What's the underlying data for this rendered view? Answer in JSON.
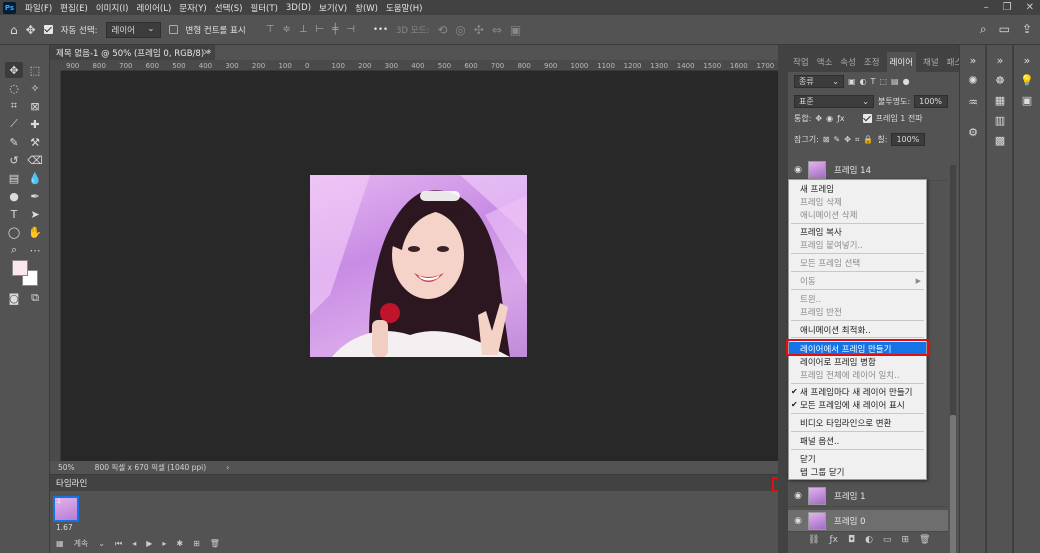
{
  "app": {
    "logo": "Ps"
  },
  "menu": [
    "파일(F)",
    "편집(E)",
    "이미지(I)",
    "레이어(L)",
    "문자(Y)",
    "선택(S)",
    "필터(T)",
    "3D(D)",
    "보기(V)",
    "창(W)",
    "도움말(H)"
  ],
  "options": {
    "auto_select_label": "자동 선택:",
    "auto_select_value": "레이어",
    "transform_label": "변형 컨트롤 표시",
    "three_d_label": "3D 모드:",
    "more": "•••"
  },
  "document": {
    "tab_title": "제목 없음-1 @ 50% (프레임 0, RGB/8) *",
    "ruler_ticks": [
      "900",
      "800",
      "700",
      "600",
      "500",
      "400",
      "300",
      "200",
      "100",
      "0",
      "100",
      "200",
      "300",
      "400",
      "500",
      "600",
      "700",
      "800",
      "900",
      "1000",
      "1100",
      "1200",
      "1300",
      "1400",
      "1500",
      "1600",
      "1700"
    ],
    "zoom": "50%",
    "size_info": "800 픽셀 x 670 픽셀 (1040 ppi)",
    "status_arrow": "›"
  },
  "timeline": {
    "title": "타임라인",
    "frame_number": "1",
    "frame_delay": "1.67",
    "loop": "계속"
  },
  "layers_panel": {
    "tabs": [
      "작업",
      "액소",
      "속성",
      "조정",
      "레이어",
      "채널",
      "패스"
    ],
    "active_tab": "레이어",
    "kind_filter": "종류",
    "blend_mode": "표준",
    "opacity_label": "불투명도:",
    "opacity_value": "100%",
    "unify_label": "통합:",
    "propagate_label": "프레임 1 전파",
    "lock_label": "잠그기:",
    "fill_label": "칠:",
    "fill_value": "100%",
    "layers": [
      {
        "name": "프레임 14",
        "selected": false
      },
      {
        "name": "프레임 1",
        "selected": false
      },
      {
        "name": "프레임 0",
        "selected": true
      }
    ]
  },
  "flyout_menu": {
    "items": [
      {
        "label": "새 프레임",
        "state": "enabled"
      },
      {
        "label": "프레임 삭제",
        "state": "disabled"
      },
      {
        "label": "애니메이션 삭제",
        "state": "disabled"
      },
      {
        "label": "프레임 복사",
        "state": "enabled"
      },
      {
        "label": "프레임 붙여넣기..",
        "state": "disabled"
      },
      {
        "label": "모든 프레임 선택",
        "state": "disabled"
      },
      {
        "label": "이동",
        "state": "disabled"
      },
      {
        "label": "트윈..",
        "state": "disabled"
      },
      {
        "label": "프레임 반전",
        "state": "disabled"
      },
      {
        "label": "애니메이션 최적화..",
        "state": "enabled"
      },
      {
        "label": "레이어에서 프레임 만들기",
        "state": "highlighted"
      },
      {
        "label": "레이어로 프레임 병합",
        "state": "enabled"
      },
      {
        "label": "프레임 전체에 레이어 일치..",
        "state": "disabled"
      },
      {
        "label": "새 프레임마다 새 레이어 만들기",
        "state": "checked"
      },
      {
        "label": "모든 프레임에 새 레이어 표시",
        "state": "checked"
      },
      {
        "label": "비디오 타임라인으로 변환",
        "state": "enabled"
      },
      {
        "label": "패널 옵션..",
        "state": "enabled"
      },
      {
        "label": "닫기",
        "state": "enabled"
      },
      {
        "label": "탭 그룹 닫기",
        "state": "enabled"
      }
    ]
  },
  "colors": {
    "highlight": "#1473e6",
    "annotation_red": "#e01010",
    "foreground_swatch": "#fbe7ec",
    "background_swatch": "#ffffff"
  }
}
